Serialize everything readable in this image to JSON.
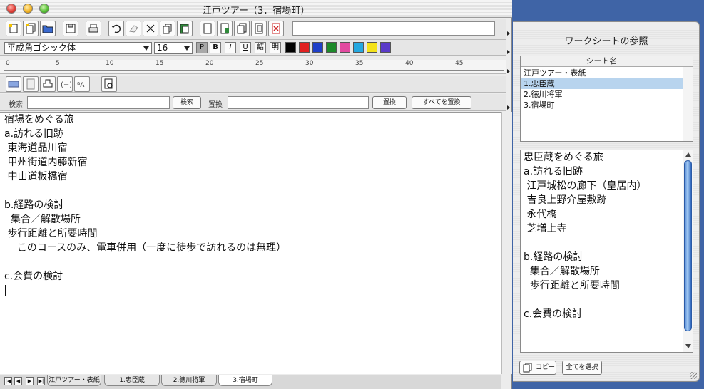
{
  "window": {
    "title": "江戸ツアー（3．宿場町）"
  },
  "toolbar": {
    "font_name": "平成角ゴシック体",
    "font_size": "16",
    "style_buttons": [
      "P",
      "B",
      "I",
      "U",
      "詰",
      "明"
    ],
    "swatch_colors": [
      "#000000",
      "#e02020",
      "#1f3fc8",
      "#1d8a2a",
      "#e24aa0",
      "#24a8e0",
      "#f4e21a",
      "#5a3ac8"
    ]
  },
  "ruler": {
    "marks": [
      "0",
      "5",
      "10",
      "15",
      "20",
      "25",
      "30",
      "35",
      "40",
      "45"
    ]
  },
  "search": {
    "search_label": "検索",
    "search_button": "検索",
    "replace_label": "置換",
    "replace_button": "置換",
    "replace_all_button": "すべてを置換"
  },
  "editor": {
    "lines": [
      "宿場をめぐる旅",
      "a.訪れる旧跡",
      " 東海道品川宿",
      " 甲州街道内藤新宿",
      " 中山道板橋宿",
      "",
      "b.経路の検討",
      "  集合／解散場所",
      " 歩行距離と所要時間",
      "    このコースのみ、電車併用（一度に徒歩で訪れるのは無理）",
      "",
      "c.会費の検討"
    ]
  },
  "tabs": [
    {
      "label": "江戸ツアー・表紙"
    },
    {
      "label": "1.忠臣蔵"
    },
    {
      "label": "2.徳川将軍"
    },
    {
      "label": "3.宿場町"
    }
  ],
  "drawer": {
    "title": "ワークシートの参照",
    "list_header": "シート名",
    "sheets": [
      "江戸ツアー・表紙",
      "1.忠臣蔵",
      "2.徳川将軍",
      "3.宿場町"
    ],
    "selected_index": 1,
    "preview_lines": [
      "忠臣蔵をめぐる旅",
      "a.訪れる旧跡",
      " 江戸城松の廊下（皇居内）",
      " 吉良上野介屋敷跡",
      " 永代橋",
      " 芝増上寺",
      "",
      "b.経路の検討",
      "  集合／解散場所",
      "  歩行距離と所要時間",
      "",
      "c.会費の検討"
    ],
    "copy_button": "コピー",
    "select_all_button": "全てを選択"
  }
}
